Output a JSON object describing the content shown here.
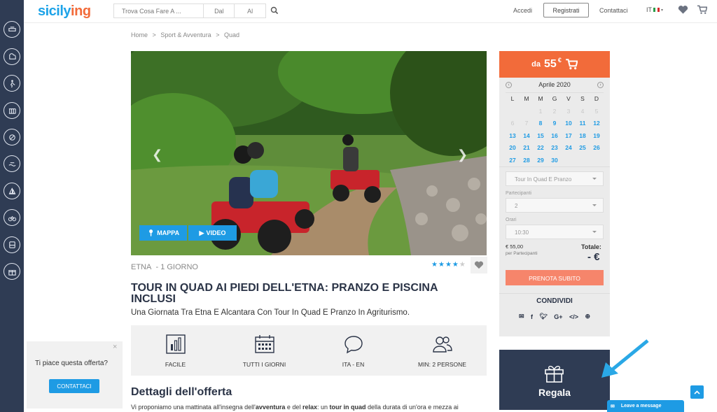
{
  "header": {
    "logo": {
      "part1": "sicily",
      "part2": "ing"
    },
    "search": {
      "what_placeholder": "Trova Cosa Fare A ...",
      "from_placeholder": "Dal",
      "to_placeholder": "Al"
    },
    "login_label": "Accedi",
    "register_label": "Registrati",
    "contact_label": "Contattaci",
    "language": "IT"
  },
  "breadcrumb": [
    "Home",
    ">",
    "Sport & Avventura",
    ">",
    "Quad"
  ],
  "hero": {
    "map_label": "MAPPA",
    "video_label": "VIDEO"
  },
  "tour": {
    "location": "ETNA",
    "duration": "- 1 GIORNO",
    "rating": 4,
    "rating_max": 5,
    "title": "TOUR IN QUAD AI PIEDI DELL'ETNA: PRANZO E PISCINA INCLUSI",
    "subtitle": "Una Giornata Tra Etna E Alcantara Con Tour In Quad E Pranzo In Agriturismo."
  },
  "features": [
    {
      "label": "FACILE",
      "icon": "difficulty-bars-icon"
    },
    {
      "label": "TUTTI I GIORNI",
      "icon": "calendar-icon"
    },
    {
      "label": "ITA - EN",
      "icon": "speech-bubble-icon"
    },
    {
      "label": "MIN: 2 PERSONE",
      "icon": "people-icon"
    }
  ],
  "details": {
    "heading": "Dettagli dell'offerta",
    "text_parts": [
      "Vi proponiamo una mattinata all'insegna dell'",
      "avventura",
      " e del ",
      "relax",
      ": un ",
      "tour in quad",
      " della durata di un'ora e mezza ai"
    ]
  },
  "popup": {
    "question": "Ti piace questa offerta?",
    "button": "CONTATTACI",
    "close": "×"
  },
  "booking": {
    "price_prefix": "da",
    "price": "55",
    "currency": "€",
    "month": "Aprile 2020",
    "weekdays": [
      "L",
      "M",
      "M",
      "G",
      "V",
      "S",
      "D"
    ],
    "weeks": [
      [
        "",
        "",
        "1",
        "2",
        "3",
        "4",
        "5"
      ],
      [
        "6",
        "7",
        "8",
        "9",
        "10",
        "11",
        "12"
      ],
      [
        "13",
        "14",
        "15",
        "16",
        "17",
        "18",
        "19"
      ],
      [
        "20",
        "21",
        "22",
        "23",
        "24",
        "25",
        "26"
      ],
      [
        "27",
        "28",
        "29",
        "30",
        "",
        "",
        ""
      ]
    ],
    "first_available_day": 8,
    "tour_select": "Tour In Quad E Pranzo",
    "participants_label": "Partecipanti",
    "participants_value": "2",
    "time_label": "Orari",
    "time_value": "10:30",
    "per_person_price": "€ 55,00",
    "per_person_label": "per Partecipanti",
    "total_label": "Totale:",
    "total_value": "- €",
    "book_button": "PRENOTA SUBITO",
    "share_heading": "CONDIVIDI"
  },
  "regala": {
    "label": "Regala"
  },
  "chat": {
    "label": "Leave a message"
  },
  "colors": {
    "brand_blue": "#1e9be4",
    "brand_orange": "#f26b3a",
    "navy": "#2f3c54"
  }
}
